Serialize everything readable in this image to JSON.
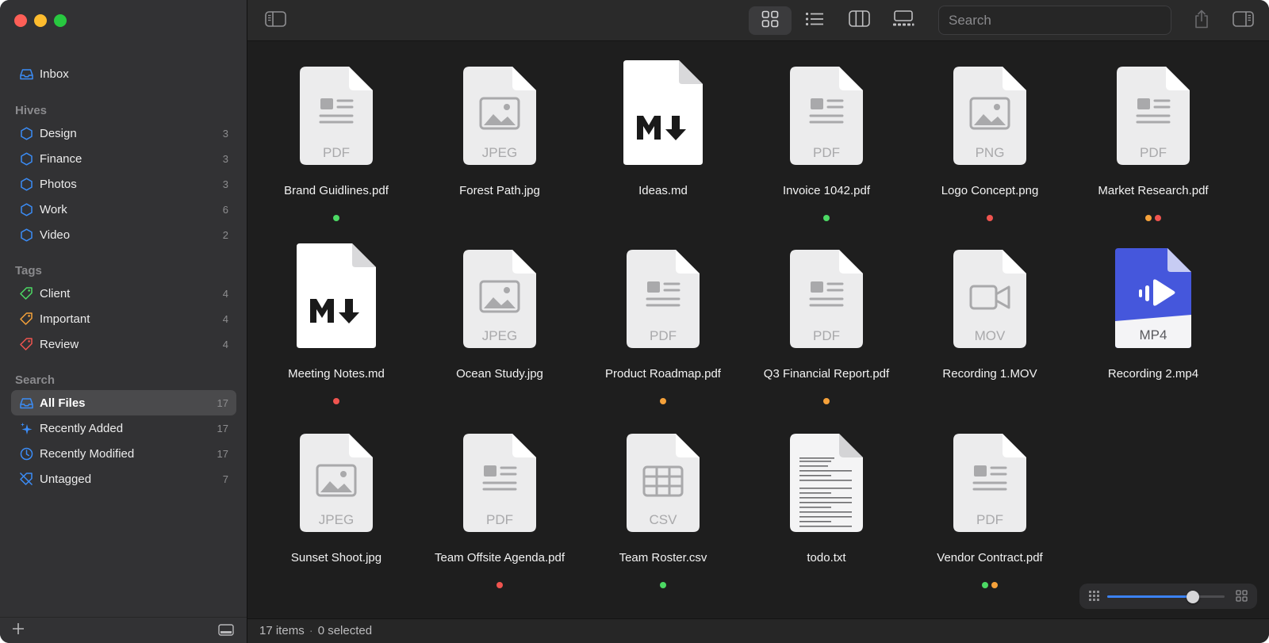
{
  "sidebar": {
    "inbox": {
      "label": "Inbox",
      "icon": "inbox-icon"
    },
    "hives_heading": "Hives",
    "hives": [
      {
        "label": "Design",
        "count": "3"
      },
      {
        "label": "Finance",
        "count": "3"
      },
      {
        "label": "Photos",
        "count": "3"
      },
      {
        "label": "Work",
        "count": "6"
      },
      {
        "label": "Video",
        "count": "2"
      }
    ],
    "tags_heading": "Tags",
    "tags": [
      {
        "label": "Client",
        "count": "4",
        "color": "#4cd964"
      },
      {
        "label": "Important",
        "count": "4",
        "color": "#f5a13a"
      },
      {
        "label": "Review",
        "count": "4",
        "color": "#f0544f"
      }
    ],
    "search_heading": "Search",
    "searches": [
      {
        "label": "All Files",
        "count": "17",
        "icon": "all-files-icon",
        "active": true
      },
      {
        "label": "Recently Added",
        "count": "17",
        "icon": "sparkle-icon"
      },
      {
        "label": "Recently Modified",
        "count": "17",
        "icon": "clock-icon"
      },
      {
        "label": "Untagged",
        "count": "7",
        "icon": "untagged-icon"
      }
    ]
  },
  "toolbar": {
    "search_placeholder": "Search",
    "views": [
      "grid-view",
      "list-view",
      "column-view",
      "gallery-view"
    ],
    "selected_view": "grid-view"
  },
  "files": [
    {
      "name": "Brand Guidlines.pdf",
      "kind": "PDF",
      "icon": "pdf-file-icon",
      "tags": [
        "#4cd964"
      ]
    },
    {
      "name": "Forest Path.jpg",
      "kind": "JPEG",
      "icon": "image-file-icon",
      "tags": []
    },
    {
      "name": "Ideas.md",
      "kind": "",
      "icon": "markdown-file-icon",
      "tags": []
    },
    {
      "name": "Invoice 1042.pdf",
      "kind": "PDF",
      "icon": "pdf-file-icon",
      "tags": [
        "#4cd964"
      ]
    },
    {
      "name": "Logo Concept.png",
      "kind": "PNG",
      "icon": "image-file-icon",
      "tags": [
        "#f0544f"
      ]
    },
    {
      "name": "Market Research.pdf",
      "kind": "PDF",
      "icon": "pdf-file-icon",
      "tags": [
        "#f5a13a",
        "#f0544f"
      ]
    },
    {
      "name": "Meeting Notes.md",
      "kind": "",
      "icon": "markdown-file-icon",
      "tags": [
        "#f0544f"
      ]
    },
    {
      "name": "Ocean Study.jpg",
      "kind": "JPEG",
      "icon": "image-file-icon",
      "tags": []
    },
    {
      "name": "Product Roadmap.pdf",
      "kind": "PDF",
      "icon": "pdf-file-icon",
      "tags": [
        "#f5a13a"
      ]
    },
    {
      "name": "Q3 Financial Report.pdf",
      "kind": "PDF",
      "icon": "pdf-file-icon",
      "tags": [
        "#f5a13a"
      ]
    },
    {
      "name": "Recording 1.MOV",
      "kind": "MOV",
      "icon": "video-file-icon",
      "tags": []
    },
    {
      "name": "Recording 2.mp4",
      "kind": "MP4",
      "icon": "mp4-file-icon",
      "tags": []
    },
    {
      "name": "Sunset Shoot.jpg",
      "kind": "JPEG",
      "icon": "image-file-icon",
      "tags": []
    },
    {
      "name": "Team Offsite Agenda.pdf",
      "kind": "PDF",
      "icon": "pdf-file-icon",
      "tags": [
        "#f0544f"
      ]
    },
    {
      "name": "Team Roster.csv",
      "kind": "CSV",
      "icon": "csv-file-icon",
      "tags": [
        "#4cd964"
      ]
    },
    {
      "name": "todo.txt",
      "kind": "",
      "icon": "text-file-icon",
      "tags": []
    },
    {
      "name": "Vendor Contract.pdf",
      "kind": "PDF",
      "icon": "pdf-file-icon",
      "tags": [
        "#4cd964",
        "#f5a13a"
      ]
    }
  ],
  "status": {
    "items": "17 items",
    "selected": "0 selected"
  },
  "zoom": {
    "level": 0.73
  },
  "colors": {
    "accent": "#3b82f6",
    "hive_icon": "#3b8cf6"
  }
}
